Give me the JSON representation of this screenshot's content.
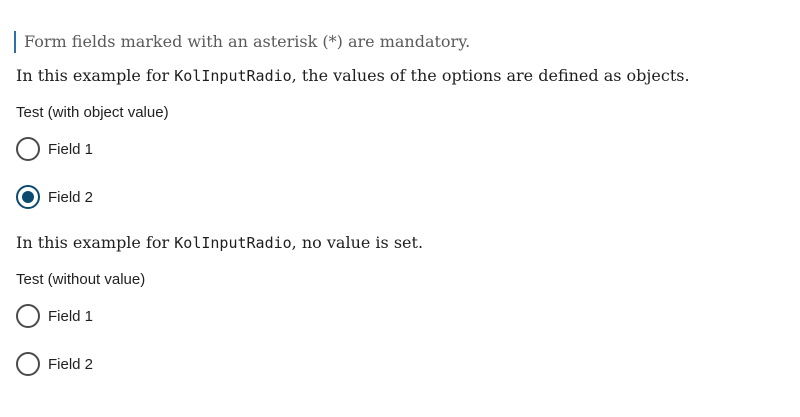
{
  "notice": {
    "text": "Form fields marked with an asterisk (*) are mandatory."
  },
  "example1": {
    "desc_prefix": "In this example for ",
    "desc_code": "KolInputRadio",
    "desc_suffix": ", the values of the options are defined as objects.",
    "legend": "Test (with object value)",
    "options": [
      {
        "label": "Field 1",
        "checked": false
      },
      {
        "label": "Field 2",
        "checked": true
      }
    ]
  },
  "example2": {
    "desc_prefix": "In this example for ",
    "desc_code": "KolInputRadio",
    "desc_suffix": ", no value is set.",
    "legend": "Test (without value)",
    "options": [
      {
        "label": "Field 1",
        "checked": false
      },
      {
        "label": "Field 2",
        "checked": false
      }
    ]
  },
  "colors": {
    "accent": "#0b4a6f",
    "notice_bar": "#2f6fa3",
    "radio_border": "#4a4a4a"
  }
}
